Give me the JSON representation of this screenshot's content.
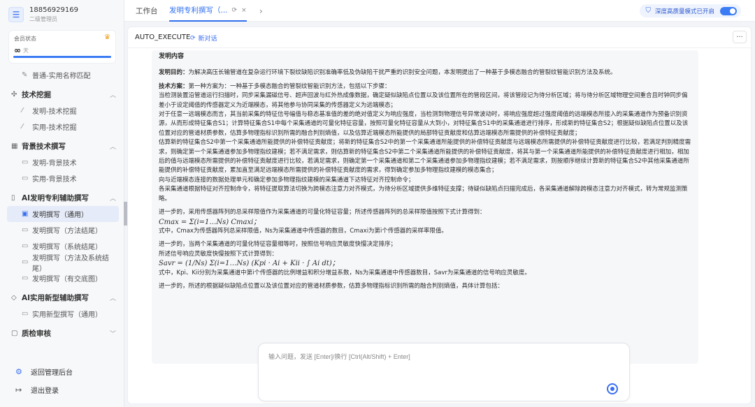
{
  "user": {
    "avatar_glyph": "☰",
    "phone": "18856929169",
    "role": "二级管理员"
  },
  "member": {
    "label": "会员状态",
    "value": "∞",
    "unit": "天",
    "progress": 1.0
  },
  "sidebar": {
    "top_item": "普通-实用名称匹配",
    "sections": [
      {
        "title": "技术挖掘",
        "items": [
          "发明-技术挖掘",
          "实用-技术挖掘"
        ]
      },
      {
        "title": "背景技术撰写",
        "items": [
          "发明-背景技术",
          "实用-背景技术"
        ]
      },
      {
        "title": "AI发明专利辅助撰写",
        "items": [
          "发明撰写（通用）",
          "发明撰写（方法结尾）",
          "发明撰写（系统结尾）",
          "发明撰写（方法及系统结尾）",
          "发明撰写（有交底图）"
        ]
      },
      {
        "title": "AI实用新型辅助撰写",
        "items": [
          "实用新型撰写（通用）"
        ]
      },
      {
        "title": "质检审核",
        "items": []
      }
    ],
    "admin_link": "返回管理后台",
    "logout_link": "退出登录"
  },
  "tabs": {
    "home": "工作台",
    "active": "发明专利撰写（...",
    "close": "×",
    "refresh": "⟳",
    "next": "›"
  },
  "deep_mode": {
    "label": "深度高质量模式已开启",
    "enabled": true
  },
  "panel": {
    "title": "AUTO_EXECUTE",
    "new_chat": "新对话",
    "more": "···"
  },
  "doc": {
    "heading": "发明内容",
    "purpose_label": "发明目的：",
    "purpose": "为解决高压长输管道在复杂运行环境下裂纹缺陷识别准确率低及伪缺陷干扰严重的识别安全问题，本发明提出了一种基于多模态融合的管裂纹智能识别方法及系统。",
    "scheme_label": "技术方案：",
    "scheme_intro": "第一种方案为：一种基于多模态融合的管裂纹智能识别方法，包括以下步骤：",
    "p1": "当检测装置沿管道运行扫描时，同步采集漏磁信号、超声回波与红外热成像数据，确定疑似缺陷点位置以及该位置所在的管段区间，将该管段记为待分析区域；将与待分析区域物理空间重合且时钟同步偏差小于设定阈值的传感器定义为近端模态，将其他参与协同采集的传感器定义为远端模态；",
    "p2": "对于任意一远端模态而言，其当前采集的特征信号幅值与稳态基准值的差的绝对值定义为响应强度，当检测到物理信号异常波动时，将响应强度超过强度阈值的远端模态所接入的采集通道作为预备识别资源，从而形成特征集合S1；计算特征集合S1中每个采集通道的可量化特征容量，按照可量化特征容量从大到小，对特征集合S1中的采集通道进行排序，形成新的特征集合S2；根据疑似缺陷点位置以及该位置对应的管道材质参数，估算多物理指标识别所需的融合判别熵值，以及估算近端模态所能提供的局部特征贡献度和估算远端模态所需提供的补偿特征贡献度；",
    "p3": "估算新的特征集合S2中第一个采集通道所能提供的补偿特征贡献度；将新的特征集合S2中的第一个采集通道所能提供的补偿特征贡献度与远端模态所需提供的补偿特征贡献度进行比较，若满足判别精度需求，则确定第一个采集通道参加多物理指纹建模；若不满足需求，则估算新的特征集合S2中第二个采集通道所能提供的补偿特征贡献度，将其与第一个采集通道所能提供的补偿特征贡献度进行相加，相加后的值与远端模态所需提供的补偿特征贡献度进行比较，若满足需求，则确定第一个采集通道和第二个采集通道参加多物理指纹建模；若不满足需求，则按顺序继续计算新的特征集合S2中其他采集通道所能提供的补偿特征贡献度，累加直至满足远端模态所需提供的补偿特征贡献度的需求，得到确定参加多物理指纹建模的模态集合；",
    "p4": "向与近端模态连接的数据处理单元和确定参加多物理指纹建模的采集通道下达特征对齐控制命令；",
    "p5": "各采集通道根据特征对齐控制命令，将特征提取算法切换为跨模态注意力对齐模式，为待分析区域提供多维特征支撑；待疑似缺陷点扫描完成后，各采集通道解除跨模态注意力对齐模式，转为常规监测策略。",
    "p6": "进一步的，采用传感器阵列的总采样限值作为采集通道的可量化特征容量；所述传感器阵列的总采样限值按照下式计算得到：",
    "f1": "Cmax = Σ(i=1…Ns) Cmaxi；",
    "p7": "式中，Cmax为传感器阵列总采样限值，Ns为采集通道中传感器的数目，Cmaxi为第i个传感器的采样率限值。",
    "p8": "进一步的，当两个采集通道的可量化特征容量相等时，按照信号响应灵敏度快慢决定排序；",
    "p9": "所述信号响应灵敏度快慢按照下式计算得到：",
    "f2": "Savr = (1/Ns) Σ(i=1…Ns) (Kpi · Ai + Kii · ∫ Ai dt)；",
    "p10": "式中，Kpi、Kii分别为采集通道中第i个传感器的比例增益和积分增益系数，Ns为采集通道中传感器数目，Savr为采集通道的信号响应灵敏度。",
    "p11": "进一步的，所述的根据疑似缺陷点位置以及该位置对应的管道材质参数，估算多物理指标识别所需的融合判别熵值，具体计算包括："
  },
  "composer": {
    "placeholder": "输入问题，发送 [Enter]/换行 [Ctrl(Alt/Shift) + Enter]"
  }
}
